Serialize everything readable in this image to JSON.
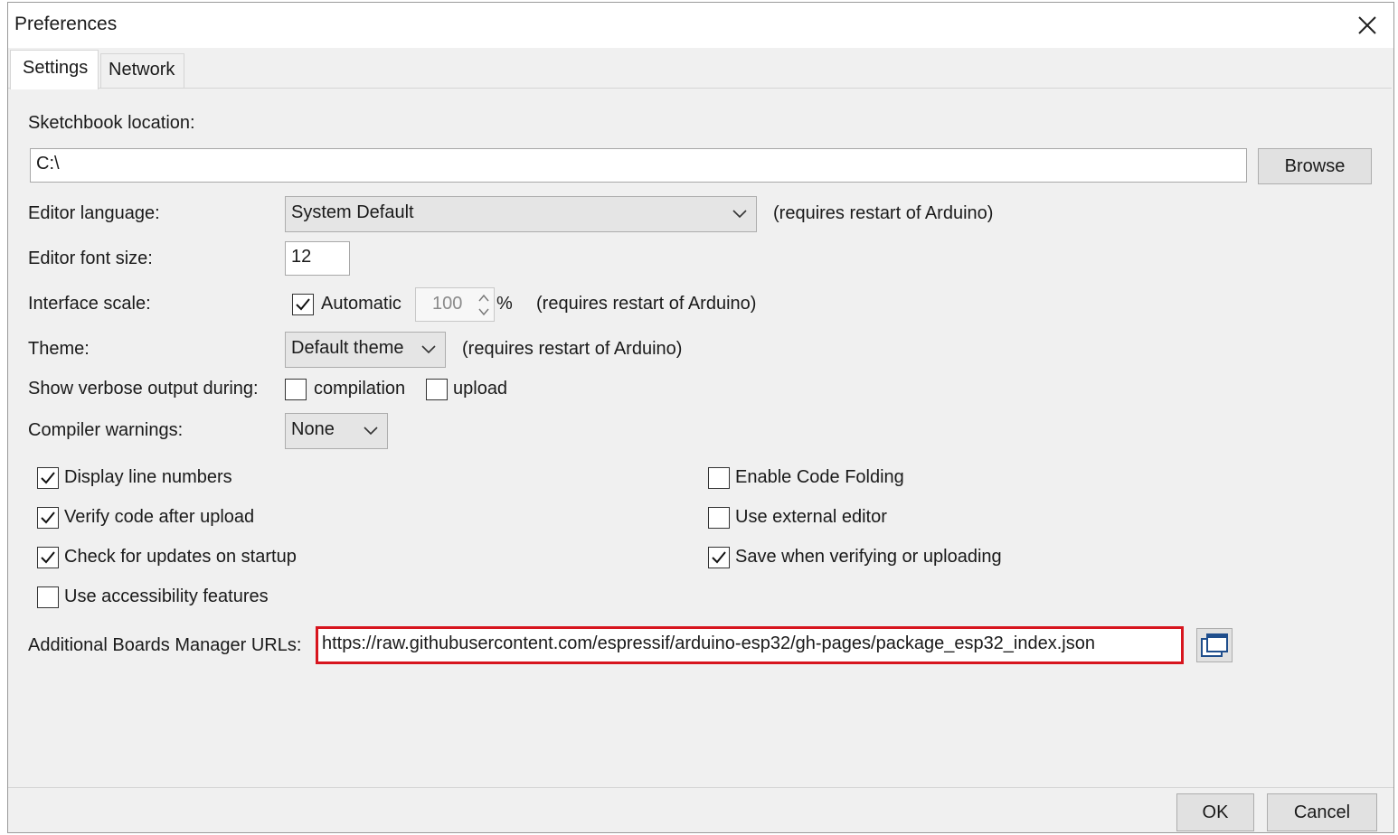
{
  "window": {
    "title": "Preferences"
  },
  "tabs": [
    {
      "label": "Settings"
    },
    {
      "label": "Network"
    }
  ],
  "settings": {
    "sketchbook": {
      "label": "Sketchbook location:",
      "value": "C:\\",
      "browse_label": "Browse"
    },
    "editor_language": {
      "label": "Editor language:",
      "selected": "System Default",
      "note": "(requires restart of Arduino)"
    },
    "font_size": {
      "label": "Editor font size:",
      "value": "12"
    },
    "interface_scale": {
      "label": "Interface scale:",
      "automatic_label": "Automatic",
      "automatic_checked": true,
      "value": "100",
      "unit": "%",
      "note": "(requires restart of Arduino)"
    },
    "theme": {
      "label": "Theme:",
      "selected": "Default theme",
      "note": "(requires restart of Arduino)"
    },
    "verbose": {
      "label": "Show verbose output during:",
      "compilation_label": "compilation",
      "compilation_checked": false,
      "upload_label": "upload",
      "upload_checked": false
    },
    "compiler_warnings": {
      "label": "Compiler warnings:",
      "selected": "None"
    },
    "options_left": [
      {
        "label": "Display line numbers",
        "checked": true
      },
      {
        "label": "Verify code after upload",
        "checked": true
      },
      {
        "label": "Check for updates on startup",
        "checked": true
      },
      {
        "label": "Use accessibility features",
        "checked": false
      }
    ],
    "options_right": [
      {
        "label": "Enable Code Folding",
        "checked": false
      },
      {
        "label": "Use external editor",
        "checked": false
      },
      {
        "label": "Save when verifying or uploading",
        "checked": true
      }
    ],
    "boards_urls": {
      "label": "Additional Boards Manager URLs:",
      "value": "https://raw.githubusercontent.com/espressif/arduino-esp32/gh-pages/package_esp32_index.json",
      "highlight_color": "#d7151e"
    }
  },
  "footer": {
    "ok_label": "OK",
    "cancel_label": "Cancel"
  }
}
